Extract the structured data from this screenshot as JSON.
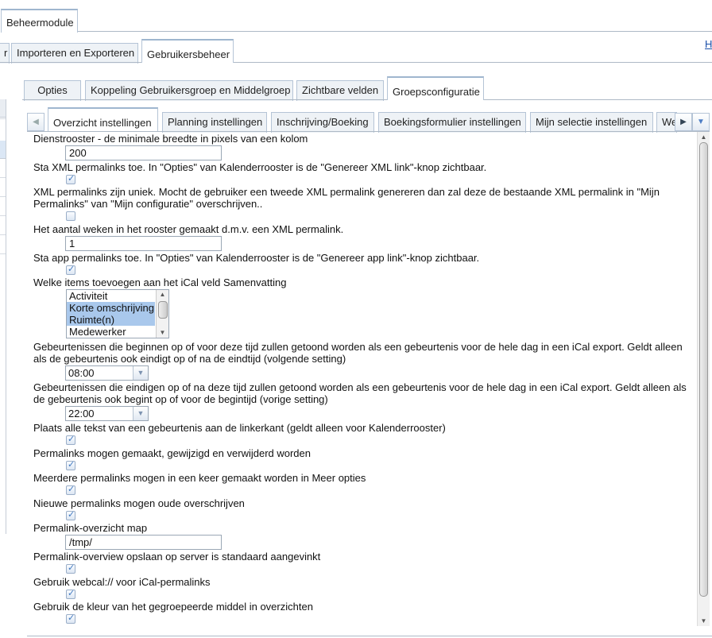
{
  "top_tabs": {
    "beheermodule": "Beheermodule"
  },
  "second_tabs": {
    "left_partial": "r",
    "importeren": "Importeren en Exporteren",
    "gebruikersbeheer": "Gebruikersbeheer"
  },
  "help_link": "H",
  "third_tabs": {
    "opties": "Opties",
    "koppeling": "Koppeling Gebruikersgroep en Middelgroep",
    "zichtbare": "Zichtbare velden",
    "groepsconfig": "Groepsconfiguratie"
  },
  "fourth_tabs": {
    "overzicht": "Overzicht instellingen",
    "planning": "Planning instellingen",
    "inschrijving": "Inschrijving/Boeking",
    "boekingsformulier": "Boekingsformulier instellingen",
    "mijnselectie": "Mijn selectie instellingen",
    "partial": "We"
  },
  "settings": {
    "dienstrooster_label": "Dienstrooster - de minimale breedte in pixels van een kolom",
    "dienstrooster_value": "200",
    "xml_perm_label": "Sta XML permalinks toe. In \"Opties\" van Kalenderrooster is de \"Genereer XML link\"-knop zichtbaar.",
    "xml_unique_label": "XML permalinks zijn uniek. Mocht de gebruiker een tweede XML permalink genereren dan zal deze de bestaande XML permalink in \"Mijn Permalinks\" van \"Mijn configuratie\" overschrijven..",
    "weken_label": "Het aantal weken in het rooster gemaakt d.m.v. een XML permalink.",
    "weken_value": "1",
    "app_perm_label": "Sta app permalinks toe. In \"Opties\" van Kalenderrooster is de \"Genereer app link\"-knop zichtbaar.",
    "ical_items_label": "Welke items toevoegen aan het iCal veld Samenvatting",
    "ical_items": [
      "Activiteit",
      "Korte omschrijving",
      "Ruimte(n)",
      "Medewerker"
    ],
    "begin_label": "Gebeurtenissen die beginnen op of voor deze tijd zullen getoond worden als een gebeurtenis voor de hele dag in een iCal export. Geldt alleen als de gebeurtenis ook eindigt op of na de eindtijd (volgende setting)",
    "begin_value": "08:00",
    "eind_label": "Gebeurtenissen die eindigen op of na deze tijd zullen getoond worden als een gebeurtenis voor de hele dag in een iCal export. Geldt alleen als de gebeurtenis ook begint op of voor de begintijd (vorige setting)",
    "eind_value": "22:00",
    "linkerkant_label": "Plaats alle tekst van een gebeurtenis aan de linkerkant (geldt alleen voor Kalenderrooster)",
    "perm_maken_label": "Permalinks mogen gemaakt, gewijzigd en verwijderd worden",
    "meerdere_label": "Meerdere permalinks mogen in een keer gemaakt worden in Meer opties",
    "nieuwe_label": "Nieuwe permalinks mogen oude overschrijven",
    "map_label": "Permalink-overzicht map",
    "map_value": "/tmp/",
    "opslaan_label": "Permalink-overview opslaan op server is standaard aangevinkt",
    "webcal_label": "Gebruik webcal:// voor iCal-permalinks",
    "kleur_label": "Gebruik de kleur van het gegroepeerde middel in overzichten"
  }
}
